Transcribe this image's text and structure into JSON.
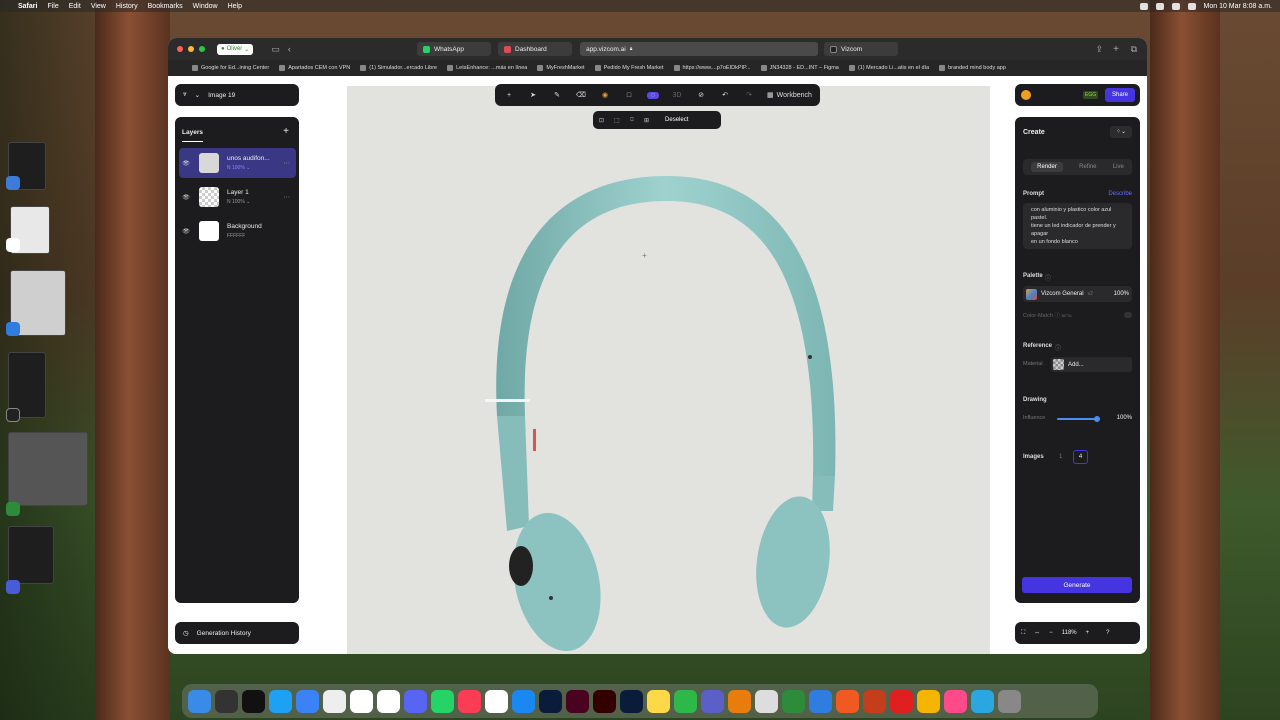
{
  "menubar": {
    "items": [
      "Safari",
      "File",
      "Edit",
      "View",
      "History",
      "Bookmarks",
      "Window",
      "Help"
    ],
    "clock": "Mon 10 Mar  8:08 a.m."
  },
  "browser": {
    "profile": "Oliver",
    "tabs": [
      "WhatsApp",
      "Dashboard",
      "app.vizcom.ai",
      "Vizcom"
    ],
    "bookmarks": [
      "Google for Ed...ining Center",
      "Apartados CEM con VPN",
      "(1) Simulador...ercado Libre",
      "LetsEnhance: ...más en línea",
      "MyFreshMarket",
      "Pedido My Fresh Market",
      "https://www....p7oEIDkPIP...",
      "JN34328 - ED...INT – Figma",
      "(1) Mercado Li...atis en el día",
      "branded mind body app"
    ]
  },
  "app": {
    "file_name": "Image 19",
    "layers_title": "Layers",
    "layers": [
      {
        "name": "unos audifon...",
        "sub": "N 100% ⌄"
      },
      {
        "name": "Layer 1",
        "sub": "N 100% ⌄"
      },
      {
        "name": "Background",
        "sub": "FFFFFF"
      }
    ],
    "generation_history": "Generation History",
    "toolbar": {
      "workbench": "Workbench",
      "deselect": "Deselect"
    },
    "share": "Share",
    "create": {
      "title": "Create",
      "modes": [
        "Render",
        "Refine",
        "Live"
      ],
      "prompt_label": "Prompt",
      "describe": "Describe",
      "prompt_text": "con aluminio y plastico color azul pastel.\ntiene un led indicador de prender y apagar\nen un fondo blanco",
      "palette_label": "Palette",
      "palette_name": "Vizcom General",
      "palette_version": "v2",
      "palette_pct": "100%",
      "color_match": "Color-Match",
      "color_match_badge": "BETA",
      "reference_label": "Reference",
      "material_label": "Material",
      "material_add": "Add...",
      "drawing_label": "Drawing",
      "influence_label": "Influence",
      "influence_value": "100%",
      "influence_level": 1.0,
      "images_label": "Images",
      "images_options": [
        "1",
        "4"
      ],
      "generate": "Generate"
    },
    "zoom": "118%"
  },
  "colors": {
    "accent": "#4535e0",
    "panel": "#1c1c1e",
    "canvas": "#e2e2df",
    "headphone": "#8fc4c2"
  }
}
